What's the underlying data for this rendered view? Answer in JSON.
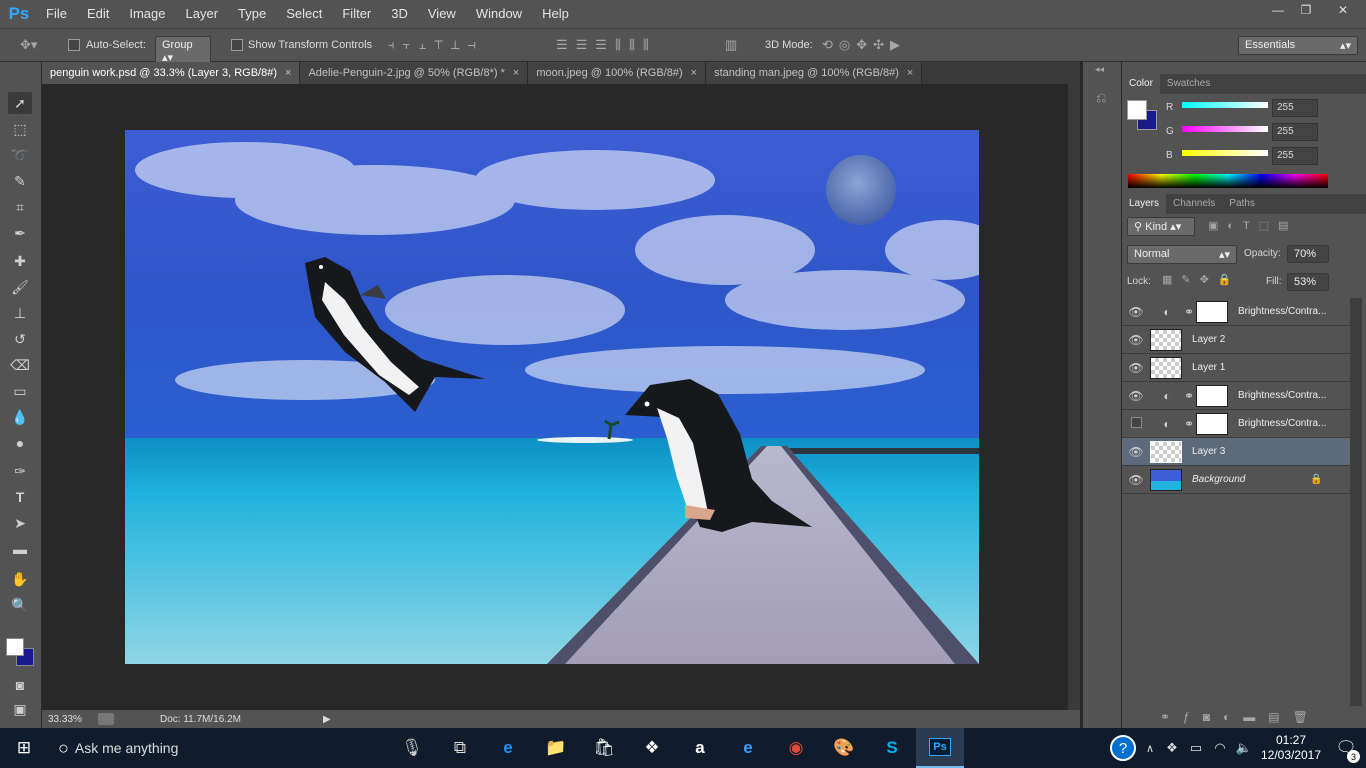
{
  "app": {
    "logo": "Ps"
  },
  "menu": [
    "File",
    "Edit",
    "Image",
    "Layer",
    "Type",
    "Select",
    "Filter",
    "3D",
    "View",
    "Window",
    "Help"
  ],
  "window_controls": {
    "minimize": "—",
    "restore": "❐",
    "close": "✕"
  },
  "options": {
    "auto_select_label": "Auto-Select:",
    "auto_select_target": "Group",
    "show_transform_label": "Show Transform Controls",
    "mode_3d_label": "3D Mode:",
    "workspace": "Essentials"
  },
  "tabs": [
    {
      "label": "penguin work.psd @ 33.3% (Layer 3, RGB/8#)",
      "active": true
    },
    {
      "label": "Adelie-Penguin-2.jpg @ 50% (RGB/8*) *",
      "active": false
    },
    {
      "label": "moon.jpeg @ 100% (RGB/8#)",
      "active": false
    },
    {
      "label": "standing man.jpeg @ 100% (RGB/8#)",
      "active": false
    }
  ],
  "tab_close": "×",
  "status": {
    "zoom": "33.33%",
    "doc": "Doc: 11.7M/16.2M"
  },
  "color_panel": {
    "tabs": [
      "Color",
      "Swatches"
    ],
    "r_label": "R",
    "r": "255",
    "g_label": "G",
    "g": "255",
    "b_label": "B",
    "b": "255"
  },
  "layers_panel": {
    "tabs": [
      "Layers",
      "Channels",
      "Paths"
    ],
    "kind": "Kind",
    "blend_mode": "Normal",
    "opacity_label": "Opacity:",
    "opacity": "70%",
    "lock_label": "Lock:",
    "fill_label": "Fill:",
    "fill": "53%",
    "layers": [
      {
        "name": "Brightness/Contra...",
        "type": "adjustment",
        "visible": true,
        "selected": false
      },
      {
        "name": "Layer 2",
        "type": "pixel",
        "visible": true,
        "selected": false
      },
      {
        "name": "Layer 1",
        "type": "pixel",
        "visible": true,
        "selected": false
      },
      {
        "name": "Brightness/Contra...",
        "type": "adjustment",
        "visible": true,
        "selected": false
      },
      {
        "name": "Brightness/Contra...",
        "type": "adjustment",
        "visible": false,
        "selected": false
      },
      {
        "name": "Layer 3",
        "type": "pixel",
        "visible": true,
        "selected": true
      },
      {
        "name": "Background",
        "type": "background",
        "visible": true,
        "selected": false
      }
    ]
  },
  "taskbar": {
    "search_placeholder": "Ask me anything",
    "time": "01:27",
    "date": "12/03/2017",
    "notification_count": "3"
  },
  "colors": {
    "foreground": "#ffffff",
    "background": "#1a1a8c",
    "ps_blue": "#31a8ff"
  }
}
